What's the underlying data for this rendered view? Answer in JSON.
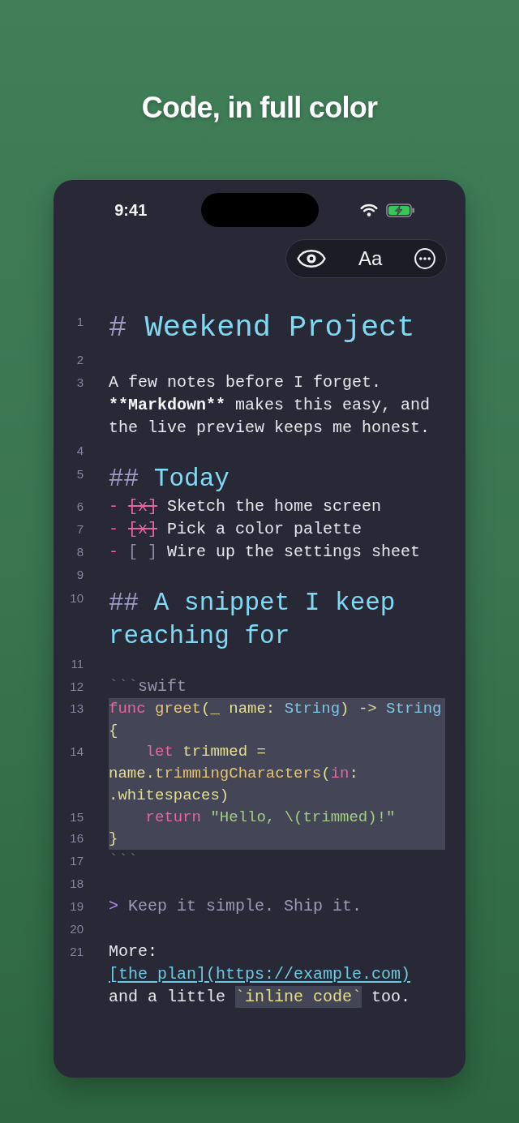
{
  "headline": "Code, in full color",
  "status_bar": {
    "time": "9:41"
  },
  "toolbar": {
    "buttons": [
      {
        "kind": "eye"
      },
      {
        "kind": "text",
        "label": "Aa"
      },
      {
        "kind": "ellipsis"
      }
    ]
  },
  "editor": {
    "lines": [
      {
        "number": "1",
        "kind": "heading1",
        "marker": "#",
        "text": "Weekend Project"
      },
      {
        "number": "2",
        "kind": "blank"
      },
      {
        "number": "3",
        "kind": "paragraph",
        "parts": [
          {
            "kind": "plain",
            "text": "A few notes before I forget. "
          },
          {
            "kind": "strong",
            "text": "**Markdown**"
          },
          {
            "kind": "plain",
            "text": " makes this easy, and the live preview keeps me honest."
          }
        ]
      },
      {
        "number": "4",
        "kind": "blank"
      },
      {
        "number": "5",
        "kind": "heading2",
        "marker": "##",
        "text": "Today"
      },
      {
        "number": "6",
        "kind": "task",
        "bullet": "-",
        "box": "[x]",
        "checked": true,
        "text": "Sketch the home screen"
      },
      {
        "number": "7",
        "kind": "task",
        "bullet": "-",
        "box": "[x]",
        "checked": true,
        "text": "Pick a color palette"
      },
      {
        "number": "8",
        "kind": "task",
        "bullet": "-",
        "box": "[ ]",
        "checked": false,
        "text": "Wire up the settings sheet"
      },
      {
        "number": "9",
        "kind": "blank"
      },
      {
        "number": "10",
        "kind": "heading2",
        "marker": "##",
        "text": "A snippet I keep reaching for"
      },
      {
        "number": "11",
        "kind": "blank"
      },
      {
        "number": "12",
        "kind": "fence",
        "marker": "```",
        "lang": "swift"
      },
      {
        "number": "13",
        "kind": "code",
        "tokens": [
          {
            "kind": "keyword",
            "text": "func"
          },
          {
            "kind": "function",
            "text": " greet"
          },
          {
            "kind": "plain",
            "text": "(_ name: "
          },
          {
            "kind": "type",
            "text": "String"
          },
          {
            "kind": "plain",
            "text": ") -> "
          },
          {
            "kind": "type",
            "text": "String"
          },
          {
            "kind": "plain",
            "text": " {"
          }
        ]
      },
      {
        "number": "14",
        "kind": "code",
        "tokens": [
          {
            "kind": "keyword",
            "text": "    let"
          },
          {
            "kind": "plain",
            "text": " trimmed = name."
          },
          {
            "kind": "function",
            "text": "trimmingCharacters"
          },
          {
            "kind": "plain",
            "text": "("
          },
          {
            "kind": "keyword",
            "text": "in"
          },
          {
            "kind": "plain",
            "text": ": .whitespaces)"
          }
        ]
      },
      {
        "number": "15",
        "kind": "code",
        "tokens": [
          {
            "kind": "keyword",
            "text": "    return"
          },
          {
            "kind": "string",
            "text": " \"Hello, \\(trimmed)!\""
          }
        ]
      },
      {
        "number": "16",
        "kind": "code",
        "tokens": [
          {
            "kind": "plain",
            "text": "}"
          }
        ]
      },
      {
        "number": "17",
        "kind": "fence",
        "marker": "```"
      },
      {
        "number": "18",
        "kind": "blank"
      },
      {
        "number": "19",
        "kind": "quote",
        "marker": ">",
        "text": "Keep it simple. Ship it."
      },
      {
        "number": "20",
        "kind": "blank"
      },
      {
        "number": "21",
        "kind": "paragraph",
        "parts": [
          {
            "kind": "plain",
            "text": "More: "
          },
          {
            "kind": "link",
            "text": "[the plan](https://example.com)"
          },
          {
            "kind": "plain",
            "text": " and a little "
          },
          {
            "kind": "code",
            "text": "`inline code`"
          },
          {
            "kind": "plain",
            "text": " too."
          }
        ]
      }
    ]
  }
}
